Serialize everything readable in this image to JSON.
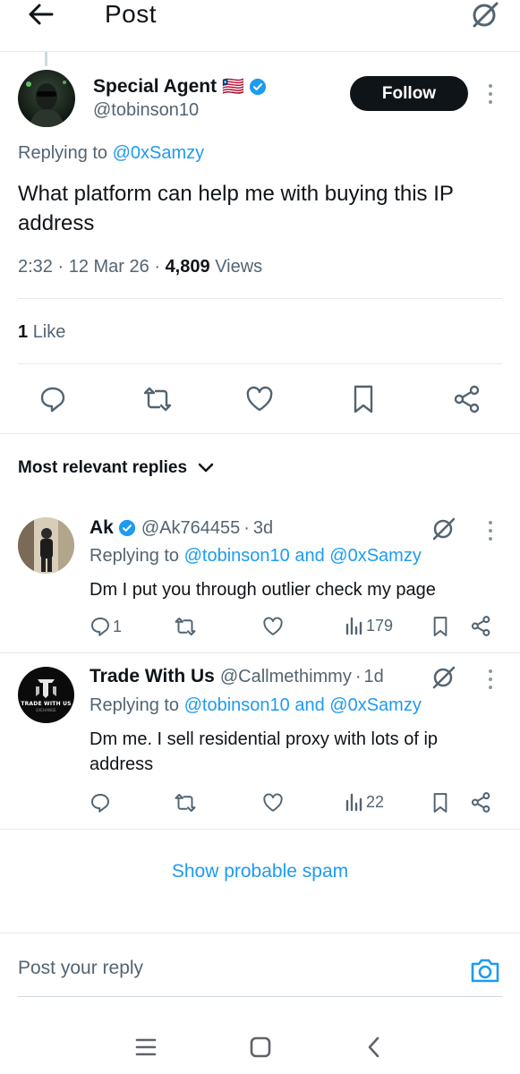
{
  "header": {
    "title": "Post"
  },
  "post": {
    "author_name": "Special Agent",
    "author_flag": "🇱🇷",
    "author_handle": "@tobinson10",
    "follow_label": "Follow",
    "replying_prefix": "Replying to ",
    "replying_to": "@0xSamzy",
    "text": "What platform can help me with buying this IP address",
    "time": "2:32",
    "date": "12 Mar 26",
    "views_count": "4,809",
    "views_label": "Views",
    "likes_count": "1",
    "likes_label": "Like"
  },
  "replies_sort_label": "Most relevant replies",
  "replies": [
    {
      "name": "Ak",
      "handle": "@Ak764455",
      "age": "3d",
      "replying_prefix": "Replying to ",
      "replying_to_1": "@tobinson10",
      "and": " and ",
      "replying_to_2": "@0xSamzy",
      "text": "Dm I put you through outlier check my page",
      "reply_count": "1",
      "retweet_count": "",
      "like_count": "",
      "views": "179"
    },
    {
      "name": "Trade With Us",
      "handle": "@Callmethimmy",
      "age": "1d",
      "avatar_text": "TRADE WITH US",
      "avatar_subtext": "EXCHANGE",
      "replying_prefix": "Replying to ",
      "replying_to_1": "@tobinson10",
      "and": " and ",
      "replying_to_2": "@0xSamzy",
      "text": "Dm me. I sell residential proxy with lots of ip address",
      "reply_count": "",
      "retweet_count": "",
      "like_count": "",
      "views": "22"
    }
  ],
  "show_spam_label": "Show probable spam",
  "compose_placeholder": "Post your reply",
  "colors": {
    "accent": "#1d9bf0",
    "text": "#0f1419",
    "muted": "#536471",
    "divider": "#e7e9ea"
  }
}
